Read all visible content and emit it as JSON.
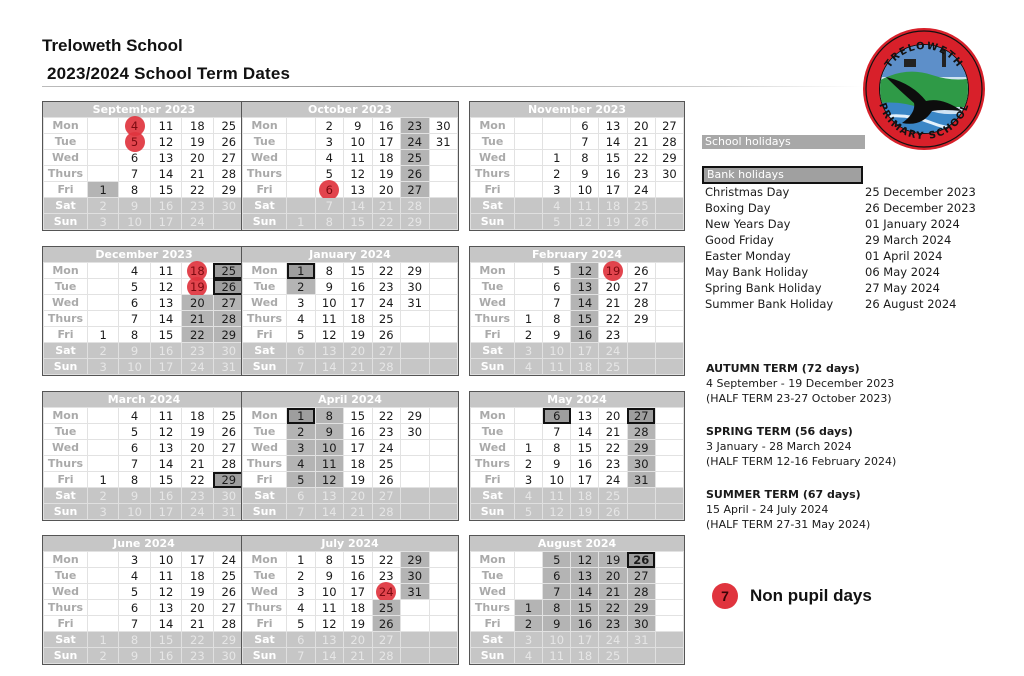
{
  "header": {
    "school_name": "Treloweth School",
    "title": "2023/2024 School Term Dates"
  },
  "logo": {
    "top_text": "TRELOWETH",
    "bottom_text": "PRIMARY SCHOOL",
    "icon": "school-crest-bird-icon"
  },
  "colors": {
    "school_holiday": "#b4b4b4",
    "bank_holiday": "#9e9e9e",
    "non_pupil_day": "#e0343e",
    "weekend": "#c6c6c6"
  },
  "day_labels": [
    "Mon",
    "Tue",
    "Wed",
    "Thurs",
    "Fri",
    "Sat",
    "Sun"
  ],
  "months": [
    {
      "name": "September 2023",
      "cols": 5,
      "rows": [
        [
          null,
          "4",
          "11",
          "18",
          "25"
        ],
        [
          null,
          "5",
          "12",
          "19",
          "26"
        ],
        [
          null,
          "6",
          "13",
          "20",
          "27"
        ],
        [
          null,
          "7",
          "14",
          "21",
          "28"
        ],
        [
          "1",
          "8",
          "15",
          "22",
          "29"
        ],
        [
          "2",
          "9",
          "16",
          "23",
          "30"
        ],
        [
          "3",
          "10",
          "17",
          "24",
          null
        ]
      ],
      "holidays": [
        "1"
      ],
      "bank": [],
      "non_pupil": [
        "4",
        "5"
      ]
    },
    {
      "name": "October 2023",
      "cols": 6,
      "rows": [
        [
          null,
          "2",
          "9",
          "16",
          "23",
          "30"
        ],
        [
          null,
          "3",
          "10",
          "17",
          "24",
          "31"
        ],
        [
          null,
          "4",
          "11",
          "18",
          "25",
          null
        ],
        [
          null,
          "5",
          "12",
          "19",
          "26",
          null
        ],
        [
          null,
          "6",
          "13",
          "20",
          "27",
          null
        ],
        [
          null,
          "7",
          "14",
          "21",
          "28",
          null
        ],
        [
          "1",
          "8",
          "15",
          "22",
          "29",
          null
        ]
      ],
      "holidays": [
        "23",
        "24",
        "25",
        "26",
        "27"
      ],
      "bank": [],
      "non_pupil": [
        "6"
      ]
    },
    {
      "name": "November 2023",
      "cols": 6,
      "rows": [
        [
          null,
          null,
          "6",
          "13",
          "20",
          "27"
        ],
        [
          null,
          null,
          "7",
          "14",
          "21",
          "28"
        ],
        [
          null,
          "1",
          "8",
          "15",
          "22",
          "29"
        ],
        [
          null,
          "2",
          "9",
          "16",
          "23",
          "30"
        ],
        [
          null,
          "3",
          "10",
          "17",
          "24",
          null
        ],
        [
          null,
          "4",
          "11",
          "18",
          "25",
          null
        ],
        [
          null,
          "5",
          "12",
          "19",
          "26",
          null
        ]
      ],
      "holidays": [],
      "bank": [],
      "non_pupil": []
    },
    {
      "name": "December 2023",
      "cols": 5,
      "rows": [
        [
          null,
          "4",
          "11",
          "18",
          "25"
        ],
        [
          null,
          "5",
          "12",
          "19",
          "26"
        ],
        [
          null,
          "6",
          "13",
          "20",
          "27"
        ],
        [
          null,
          "7",
          "14",
          "21",
          "28"
        ],
        [
          "1",
          "8",
          "15",
          "22",
          "29"
        ],
        [
          "2",
          "9",
          "16",
          "23",
          "30"
        ],
        [
          "3",
          "10",
          "17",
          "24",
          "31"
        ]
      ],
      "holidays": [
        "20",
        "21",
        "22",
        "27",
        "28",
        "29"
      ],
      "bank": [
        "25",
        "26"
      ],
      "non_pupil": [
        "18",
        "19"
      ]
    },
    {
      "name": "January 2024",
      "cols": 6,
      "rows": [
        [
          "1",
          "8",
          "15",
          "22",
          "29",
          null
        ],
        [
          "2",
          "9",
          "16",
          "23",
          "30",
          null
        ],
        [
          "3",
          "10",
          "17",
          "24",
          "31",
          null
        ],
        [
          "4",
          "11",
          "18",
          "25",
          null,
          null
        ],
        [
          "5",
          "12",
          "19",
          "26",
          null,
          null
        ],
        [
          "6",
          "13",
          "20",
          "27",
          null,
          null
        ],
        [
          "7",
          "14",
          "21",
          "28",
          null,
          null
        ]
      ],
      "holidays": [
        "2"
      ],
      "bank": [
        "1"
      ],
      "non_pupil": []
    },
    {
      "name": "February 2024",
      "cols": 6,
      "rows": [
        [
          null,
          "5",
          "12",
          "19",
          "26",
          null
        ],
        [
          null,
          "6",
          "13",
          "20",
          "27",
          null
        ],
        [
          null,
          "7",
          "14",
          "21",
          "28",
          null
        ],
        [
          "1",
          "8",
          "15",
          "22",
          "29",
          null
        ],
        [
          "2",
          "9",
          "16",
          "23",
          null,
          null
        ],
        [
          "3",
          "10",
          "17",
          "24",
          null,
          null
        ],
        [
          "4",
          "11",
          "18",
          "25",
          null,
          null
        ]
      ],
      "holidays": [
        "12",
        "13",
        "14",
        "15",
        "16"
      ],
      "bank": [],
      "non_pupil": [
        "19"
      ]
    },
    {
      "name": "March 2024",
      "cols": 5,
      "rows": [
        [
          null,
          "4",
          "11",
          "18",
          "25"
        ],
        [
          null,
          "5",
          "12",
          "19",
          "26"
        ],
        [
          null,
          "6",
          "13",
          "20",
          "27"
        ],
        [
          null,
          "7",
          "14",
          "21",
          "28"
        ],
        [
          "1",
          "8",
          "15",
          "22",
          "29"
        ],
        [
          "2",
          "9",
          "16",
          "23",
          "30"
        ],
        [
          "3",
          "10",
          "17",
          "24",
          "31"
        ]
      ],
      "holidays": [],
      "bank": [
        "29"
      ],
      "non_pupil": []
    },
    {
      "name": "April 2024",
      "cols": 6,
      "rows": [
        [
          "1",
          "8",
          "15",
          "22",
          "29",
          null
        ],
        [
          "2",
          "9",
          "16",
          "23",
          "30",
          null
        ],
        [
          "3",
          "10",
          "17",
          "24",
          null,
          null
        ],
        [
          "4",
          "11",
          "18",
          "25",
          null,
          null
        ],
        [
          "5",
          "12",
          "19",
          "26",
          null,
          null
        ],
        [
          "6",
          "13",
          "20",
          "27",
          null,
          null
        ],
        [
          "7",
          "14",
          "21",
          "28",
          null,
          null
        ]
      ],
      "holidays": [
        "2",
        "3",
        "4",
        "5",
        "8",
        "9",
        "10",
        "11",
        "12"
      ],
      "bank": [
        "1"
      ],
      "non_pupil": []
    },
    {
      "name": "May 2024",
      "cols": 6,
      "rows": [
        [
          null,
          "6",
          "13",
          "20",
          "27",
          null
        ],
        [
          null,
          "7",
          "14",
          "21",
          "28",
          null
        ],
        [
          "1",
          "8",
          "15",
          "22",
          "29",
          null
        ],
        [
          "2",
          "9",
          "16",
          "23",
          "30",
          null
        ],
        [
          "3",
          "10",
          "17",
          "24",
          "31",
          null
        ],
        [
          "4",
          "11",
          "18",
          "25",
          null,
          null
        ],
        [
          "5",
          "12",
          "19",
          "26",
          null,
          null
        ]
      ],
      "holidays": [
        "28",
        "29",
        "30",
        "31"
      ],
      "bank": [
        "6",
        "27"
      ],
      "non_pupil": []
    },
    {
      "name": "June 2024",
      "cols": 5,
      "rows": [
        [
          null,
          "3",
          "10",
          "17",
          "24"
        ],
        [
          null,
          "4",
          "11",
          "18",
          "25"
        ],
        [
          null,
          "5",
          "12",
          "19",
          "26"
        ],
        [
          null,
          "6",
          "13",
          "20",
          "27"
        ],
        [
          null,
          "7",
          "14",
          "21",
          "28"
        ],
        [
          "1",
          "8",
          "15",
          "22",
          "29"
        ],
        [
          "2",
          "9",
          "16",
          "23",
          "30"
        ]
      ],
      "holidays": [],
      "bank": [],
      "non_pupil": []
    },
    {
      "name": "July 2024",
      "cols": 6,
      "rows": [
        [
          "1",
          "8",
          "15",
          "22",
          "29",
          null
        ],
        [
          "2",
          "9",
          "16",
          "23",
          "30",
          null
        ],
        [
          "3",
          "10",
          "17",
          "24",
          "31",
          null
        ],
        [
          "4",
          "11",
          "18",
          "25",
          null,
          null
        ],
        [
          "5",
          "12",
          "19",
          "26",
          null,
          null
        ],
        [
          "6",
          "13",
          "20",
          "27",
          null,
          null
        ],
        [
          "7",
          "14",
          "21",
          "28",
          null,
          null
        ]
      ],
      "holidays": [
        "25",
        "26",
        "29",
        "30",
        "31"
      ],
      "bank": [],
      "non_pupil": [
        "24"
      ]
    },
    {
      "name": "August 2024",
      "cols": 6,
      "rows": [
        [
          null,
          "5",
          "12",
          "19",
          "26",
          null
        ],
        [
          null,
          "6",
          "13",
          "20",
          "27",
          null
        ],
        [
          null,
          "7",
          "14",
          "21",
          "28",
          null
        ],
        [
          "1",
          "8",
          "15",
          "22",
          "29",
          null
        ],
        [
          "2",
          "9",
          "16",
          "23",
          "30",
          null
        ],
        [
          "3",
          "10",
          "17",
          "24",
          "31",
          null
        ],
        [
          "4",
          "11",
          "18",
          "25",
          null,
          null
        ]
      ],
      "holidays": [
        "1",
        "2",
        "5",
        "6",
        "7",
        "8",
        "9",
        "12",
        "13",
        "14",
        "15",
        "16",
        "19",
        "20",
        "21",
        "22",
        "23",
        "27",
        "28",
        "29",
        "30"
      ],
      "bank": [
        "26"
      ],
      "non_pupil": []
    }
  ],
  "legend": {
    "school_holidays": "School holidays",
    "bank_holidays": "Bank holidays"
  },
  "bank_holidays": [
    {
      "name": "Christmas Day",
      "date": "25 December 2023"
    },
    {
      "name": "Boxing Day",
      "date": "26 December 2023"
    },
    {
      "name": "New Years Day",
      "date": "01 January 2024"
    },
    {
      "name": "Good Friday",
      "date": "29 March 2024"
    },
    {
      "name": "Easter Monday",
      "date": "01 April 2024"
    },
    {
      "name": "May Bank Holiday",
      "date": "06 May 2024"
    },
    {
      "name": "Spring Bank Holiday",
      "date": "27 May 2024"
    },
    {
      "name": "Summer Bank Holiday",
      "date": "26 August 2024"
    }
  ],
  "terms": [
    {
      "title": "AUTUMN TERM  (72 days)",
      "dates": "4 September - 19 December 2023",
      "half_term": "(HALF TERM 23-27 October 2023)"
    },
    {
      "title": "SPRING TERM (56 days)",
      "dates": "3 January - 28 March 2024",
      "half_term": "(HALF TERM 12-16 February 2024)"
    },
    {
      "title": "SUMMER TERM (67 days)",
      "dates": "15 April - 24 July 2024",
      "half_term": "(HALF TERM 27-31 May 2024)"
    }
  ],
  "non_pupil_legend": {
    "marker": "7",
    "label": "Non pupil days"
  }
}
